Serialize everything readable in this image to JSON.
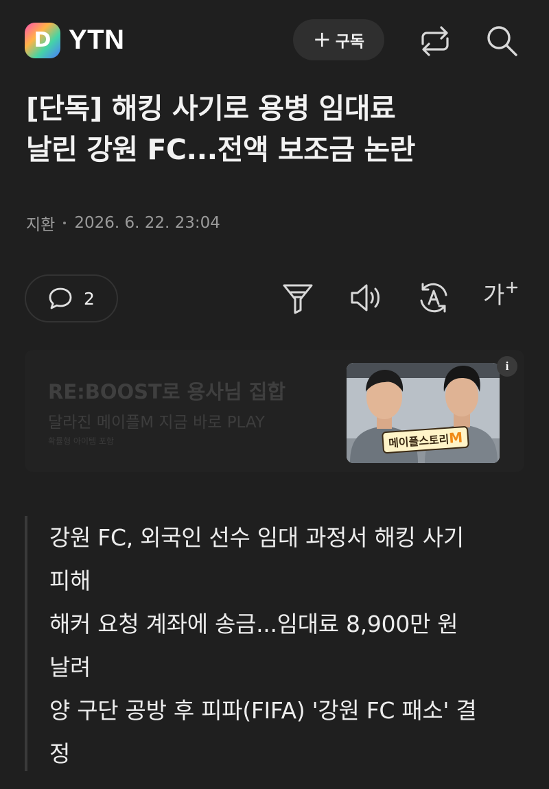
{
  "header": {
    "logo_letter": "D",
    "brand": "YTN",
    "subscribe_plus": "+",
    "subscribe_label": "구독",
    "share_icon": "share-icon",
    "search_icon": "search-icon"
  },
  "article": {
    "title_lines": [
      "[단독] 해킹 사기로 용병 임대료",
      "날린 강원 FC...전액 보조금 논란"
    ],
    "author": "지환",
    "datetime": "2026. 6. 22. 23:04"
  },
  "toolbar": {
    "comment_count": "2",
    "icons": [
      "comment-icon",
      "summary-filter-icon",
      "speaker-icon",
      "translate-icon",
      "font-size-icon"
    ],
    "font_size_label": "가"
  },
  "ad": {
    "title": "RE:BOOST로 용사님 집합",
    "subtitle": "달라진 메이플M 지금 바로 PLAY",
    "note": "확률형 아이템 포함",
    "info_label": "i",
    "logo_text": "메이플스토리",
    "logo_suffix": "M"
  },
  "summary": {
    "lines": [
      "강원 FC, 외국인 선수 임대 과정서 해킹 사기",
      "피해",
      "해커 요청 계좌에 송금...임대료 8,900만 원",
      "날려",
      "양 구단 공방 후 피파(FIFA) '강원 FC 패소' 결",
      "정"
    ]
  },
  "colors": {
    "background": "#1f1f1f",
    "text": "#ececec",
    "muted": "#9a9a9a"
  }
}
